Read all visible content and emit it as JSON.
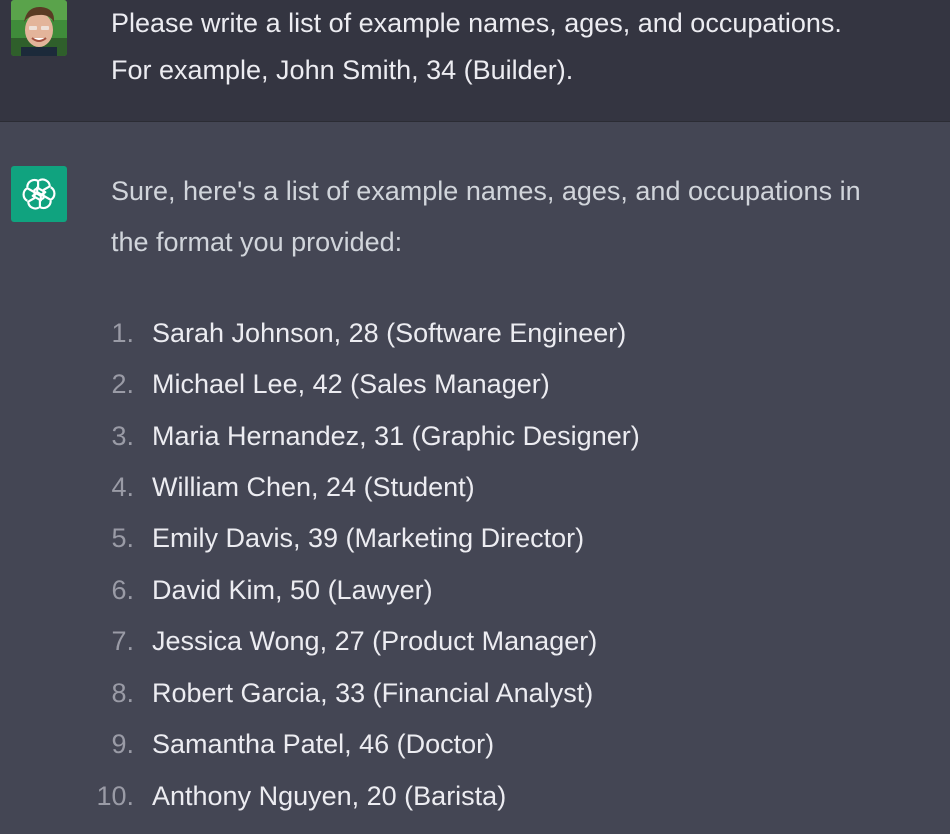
{
  "user_message": {
    "line1": "Please write a list of example names, ages, and occupations.",
    "line2": "For example, John Smith, 34 (Builder)."
  },
  "assistant_message": {
    "intro_line1": "Sure, here's a list of example names, ages, and occupations in",
    "intro_line2": "the format you provided:",
    "items": [
      {
        "num": "1.",
        "text": "Sarah Johnson, 28 (Software Engineer)"
      },
      {
        "num": "2.",
        "text": "Michael Lee, 42 (Sales Manager)"
      },
      {
        "num": "3.",
        "text": "Maria Hernandez, 31 (Graphic Designer)"
      },
      {
        "num": "4.",
        "text": "William Chen, 24 (Student)"
      },
      {
        "num": "5.",
        "text": "Emily Davis, 39 (Marketing Director)"
      },
      {
        "num": "6.",
        "text": "David Kim, 50 (Lawyer)"
      },
      {
        "num": "7.",
        "text": "Jessica Wong, 27 (Product Manager)"
      },
      {
        "num": "8.",
        "text": "Robert Garcia, 33 (Financial Analyst)"
      },
      {
        "num": "9.",
        "text": "Samantha Patel, 46 (Doctor)"
      },
      {
        "num": "10.",
        "text": "Anthony Nguyen, 20 (Barista)"
      }
    ]
  },
  "icons": {
    "user_avatar": "user-avatar-photo",
    "assistant_avatar": "openai-logo-icon"
  },
  "colors": {
    "user_row_bg": "#343541",
    "assistant_row_bg": "#444654",
    "assistant_avatar_bg": "#10a37f",
    "text": "#ececf1"
  }
}
